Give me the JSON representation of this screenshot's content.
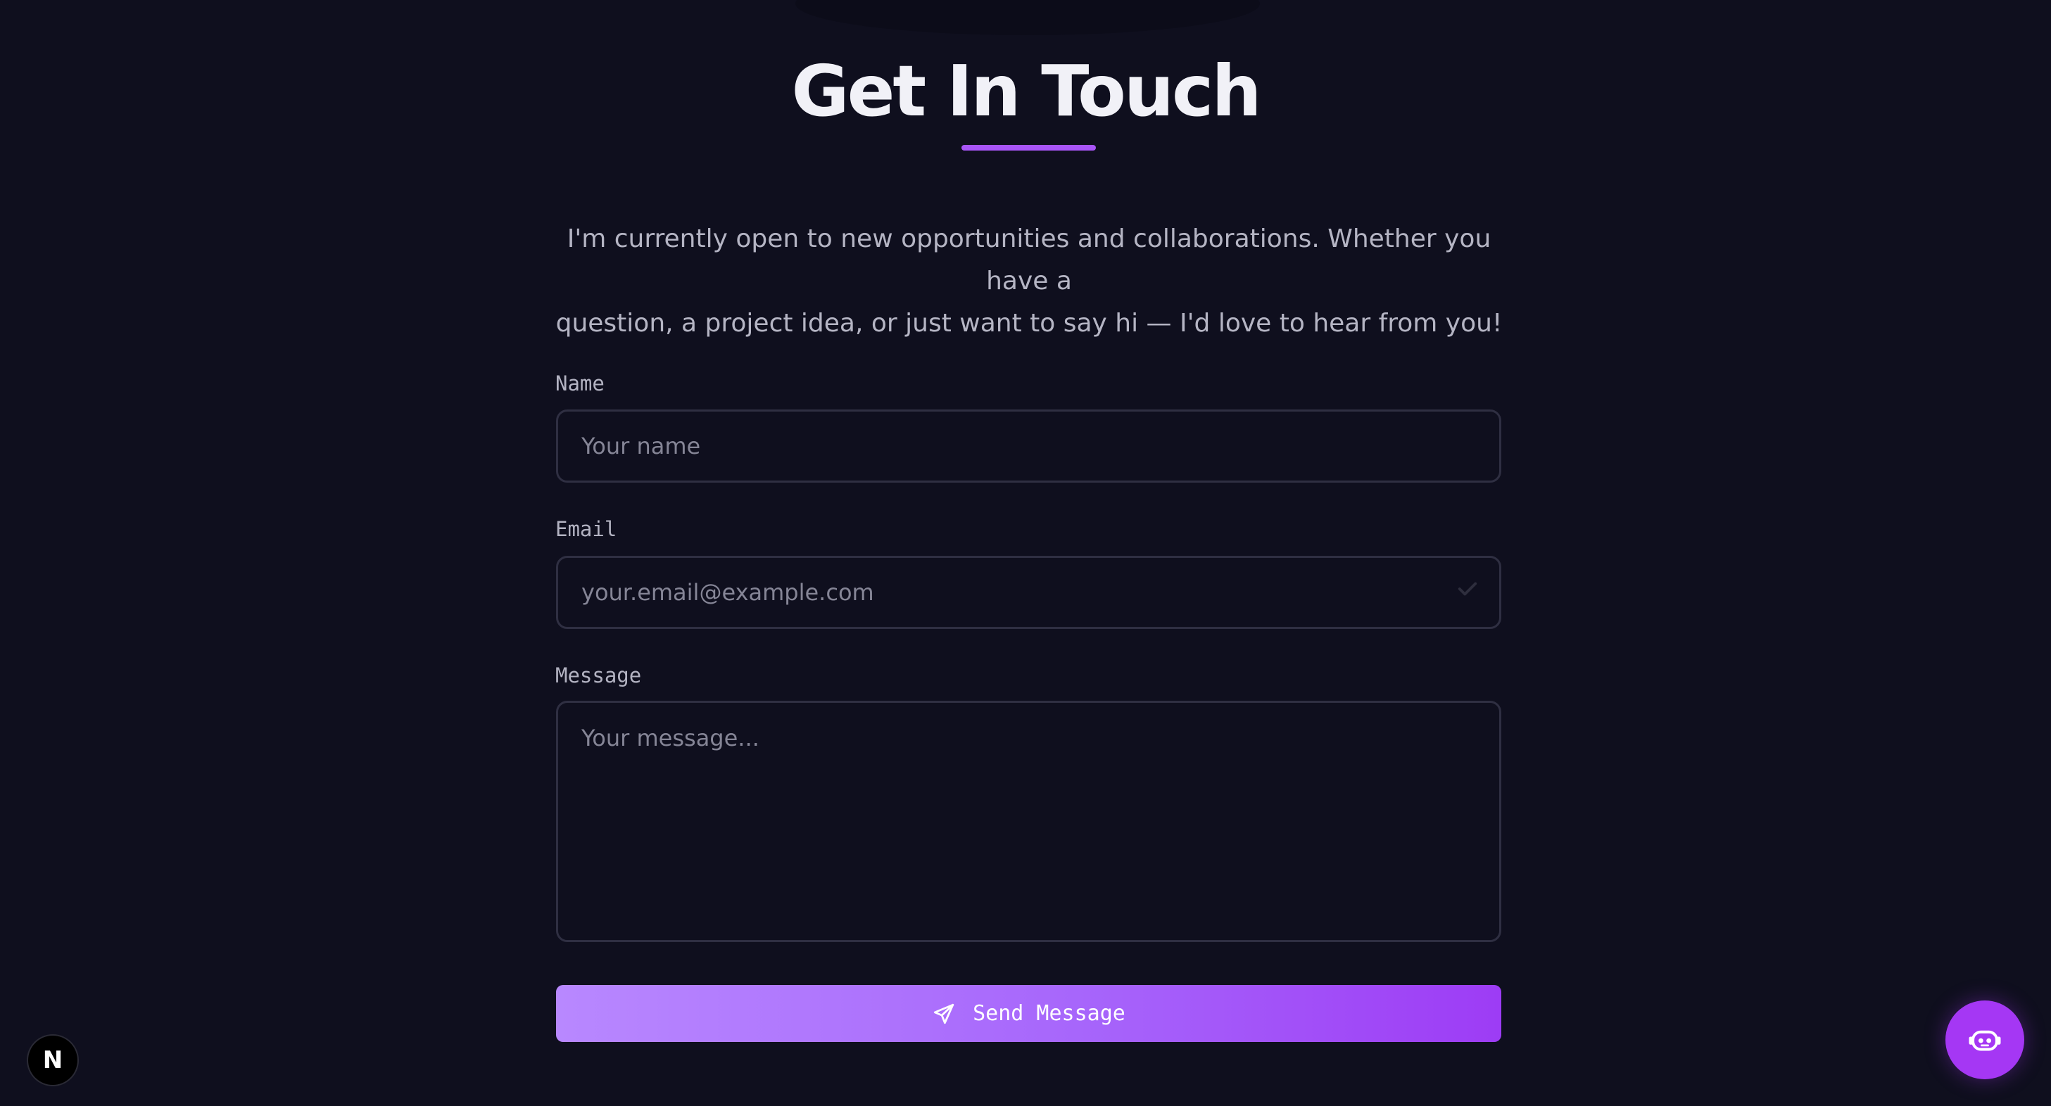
{
  "header": {
    "title": "Get In Touch",
    "intro_line1": "I'm currently open to new opportunities and collaborations. Whether you have a",
    "intro_line2": "question, a project idea, or just want to say hi — I'd love to hear from you!"
  },
  "form": {
    "name": {
      "label": "Name",
      "placeholder": "Your name",
      "value": ""
    },
    "email": {
      "label": "Email",
      "placeholder": "your.email@example.com",
      "value": ""
    },
    "message": {
      "label": "Message",
      "placeholder": "Your message...",
      "value": ""
    },
    "submit_label": "Send Message",
    "submit_icon": "send-icon"
  },
  "badges": {
    "framework_letter": "N"
  },
  "chat_widget": {
    "icon": "robot-icon"
  },
  "colors": {
    "background": "#0f0f1e",
    "accent": "#a855f7",
    "button_gradient_start": "#b888ff",
    "button_gradient_end": "#9d3cf5",
    "chat_button": "#a537f4"
  }
}
